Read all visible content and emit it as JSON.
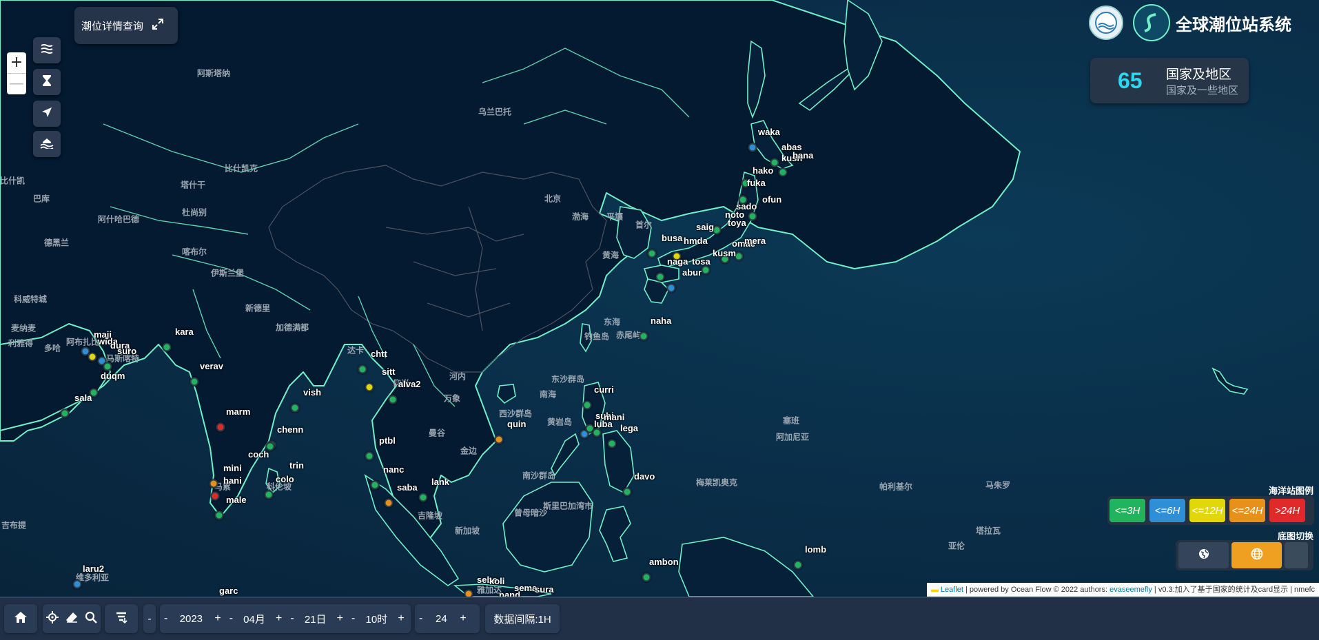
{
  "app": {
    "title": "全球潮位站系统",
    "detail_query_label": "潮位详情查询"
  },
  "zoom": {
    "in_label": "+",
    "out_label": "—"
  },
  "stats": {
    "count": "65",
    "label": "国家及地区",
    "sublabel": "国家及一些地区"
  },
  "legend": {
    "title": "海洋站图例",
    "items": [
      {
        "label": "<=3H",
        "color": "#22b35e"
      },
      {
        "label": "<=6H",
        "color": "#2f8fd6"
      },
      {
        "label": "<=12H",
        "color": "#e2d70b"
      },
      {
        "label": "<=24H",
        "color": "#e7901a"
      },
      {
        "label": ">24H",
        "color": "#e02a2a"
      }
    ],
    "basemap_title": "底图切换"
  },
  "attribution": {
    "leaflet": "Leaflet",
    "text1": " | powered by Ocean Flow © 2022 authors: ",
    "author": "evaseemefly",
    "text2": " | v0.3:加入了基于国家的统计及card显示 | nmefc"
  },
  "bottom": {
    "year": "2023",
    "month": "04月",
    "day": "21日",
    "hour": "10时",
    "interval_value": "24",
    "interval_label": "数据间隔:1H",
    "minus": "-",
    "plus": "+"
  },
  "places": [
    {
      "name": "阿斯塔纳"
    },
    {
      "name": "乌兰巴托"
    },
    {
      "name": "比什凯克"
    },
    {
      "name": "塔什干"
    },
    {
      "name": "比什凯"
    },
    {
      "name": "巴库"
    },
    {
      "name": "阿什哈巴德"
    },
    {
      "name": "杜尚别"
    },
    {
      "name": "德黑兰"
    },
    {
      "name": "喀布尔"
    },
    {
      "name": "伊斯兰堡"
    },
    {
      "name": "新德里"
    },
    {
      "name": "加德满都"
    },
    {
      "name": "达卡"
    },
    {
      "name": "北京"
    },
    {
      "name": "平壤"
    },
    {
      "name": "首尔"
    },
    {
      "name": "黄海"
    },
    {
      "name": "渤海"
    },
    {
      "name": "东海"
    },
    {
      "name": "钓鱼岛"
    },
    {
      "name": "赤尾屿"
    },
    {
      "name": "东沙群岛"
    },
    {
      "name": "南海"
    },
    {
      "name": "河内"
    },
    {
      "name": "万象"
    },
    {
      "name": "曼谷"
    },
    {
      "name": "金边"
    },
    {
      "name": "西沙群岛"
    },
    {
      "name": "南沙群岛"
    },
    {
      "name": "黄岩岛"
    },
    {
      "name": "吉隆坡"
    },
    {
      "name": "新加坡"
    },
    {
      "name": "斯里巴加湾市"
    },
    {
      "name": "曾母暗沙"
    },
    {
      "name": "塞班"
    },
    {
      "name": "阿加尼亚"
    },
    {
      "name": "梅莱凯奥克"
    },
    {
      "name": "帕利基尔"
    },
    {
      "name": "马朱罗"
    },
    {
      "name": "塔拉瓦"
    },
    {
      "name": "亚伦"
    },
    {
      "name": "科伦坡"
    },
    {
      "name": "马累"
    },
    {
      "name": "维多利亚"
    },
    {
      "name": "阿布扎比"
    },
    {
      "name": "马斯喀特"
    },
    {
      "name": "麦纳麦"
    },
    {
      "name": "利雅得"
    },
    {
      "name": "多哈"
    },
    {
      "name": "科威特城"
    },
    {
      "name": "仰光"
    },
    {
      "name": "雅加达"
    },
    {
      "name": "吉布提"
    }
  ],
  "stations": [
    {
      "name": "waka",
      "color": "#2f8fd6"
    },
    {
      "name": "abas",
      "color": "#22b35e"
    },
    {
      "name": "kush",
      "color": "#22b35e"
    },
    {
      "name": "hana",
      "color": "#22b35e"
    },
    {
      "name": "hako",
      "color": "#22b35e"
    },
    {
      "name": "fuka",
      "color": "#22b35e"
    },
    {
      "name": "ofun",
      "color": "#22b35e"
    },
    {
      "name": "sado",
      "color": "#22b35e"
    },
    {
      "name": "noto",
      "color": "#22b35e"
    },
    {
      "name": "toya",
      "color": "#22b35e"
    },
    {
      "name": "saig",
      "color": "#22b35e"
    },
    {
      "name": "busa",
      "color": "#22b35e"
    },
    {
      "name": "hmda",
      "color": "#22b35e"
    },
    {
      "name": "omae",
      "color": "#22b35e"
    },
    {
      "name": "mera",
      "color": "#22b35e"
    },
    {
      "name": "kusm",
      "color": "#22b35e"
    },
    {
      "name": "naga",
      "color": "#e2d70b"
    },
    {
      "name": "tosa",
      "color": "#22b35e"
    },
    {
      "name": "abur",
      "color": "#2f8fd6"
    },
    {
      "name": "naha",
      "color": "#22b35e"
    },
    {
      "name": "curri",
      "color": "#22b35e"
    },
    {
      "name": "subi",
      "color": "#22b35e"
    },
    {
      "name": "mani",
      "color": "#22b35e"
    },
    {
      "name": "luba",
      "color": "#2f8fd6"
    },
    {
      "name": "lega",
      "color": "#22b35e"
    },
    {
      "name": "quin",
      "color": "#e7901a"
    },
    {
      "name": "davo",
      "color": "#22b35e"
    },
    {
      "name": "chtt",
      "color": "#22b35e"
    },
    {
      "name": "sitt",
      "color": "#e2d70b"
    },
    {
      "name": "alva2",
      "color": "#22b35e"
    },
    {
      "name": "vish",
      "color": "#22b35e"
    },
    {
      "name": "chenn",
      "color": "#22b35e"
    },
    {
      "name": "ptbl",
      "color": "#22b35e"
    },
    {
      "name": "nanc",
      "color": "#22b35e"
    },
    {
      "name": "saba",
      "color": "#e7901a"
    },
    {
      "name": "lank",
      "color": "#22b35e"
    },
    {
      "name": "kara",
      "color": "#22b35e"
    },
    {
      "name": "maji",
      "color": "#2f8fd6"
    },
    {
      "name": "wida",
      "color": "#e2d70b"
    },
    {
      "name": "dura",
      "color": "#22b35e"
    },
    {
      "name": "suro",
      "color": "#2f8fd6"
    },
    {
      "name": "duqm",
      "color": "#22b35e"
    },
    {
      "name": "sala",
      "color": "#22b35e"
    },
    {
      "name": "verav",
      "color": "#22b35e"
    },
    {
      "name": "marm",
      "color": "#e02a2a"
    },
    {
      "name": "coch",
      "color": "#22b35e"
    },
    {
      "name": "mini",
      "color": "#e7901a"
    },
    {
      "name": "hani",
      "color": "#e02a2a"
    },
    {
      "name": "male",
      "color": "#22b35e"
    },
    {
      "name": "colo",
      "color": "#22b35e"
    },
    {
      "name": "trin",
      "color": "#22b35e"
    },
    {
      "name": "laru2",
      "color": "#2f8fd6"
    },
    {
      "name": "garc",
      "color": "#22b35e"
    },
    {
      "name": "lomb",
      "color": "#22b35e"
    },
    {
      "name": "ambon",
      "color": "#22b35e"
    },
    {
      "name": "sebe",
      "color": "#e7901a"
    },
    {
      "name": "koli",
      "color": "#22b35e"
    },
    {
      "name": "sema",
      "color": "#22b35e"
    },
    {
      "name": "sura",
      "color": "#22b35e"
    },
    {
      "name": "pand",
      "color": "#22b35e"
    }
  ]
}
